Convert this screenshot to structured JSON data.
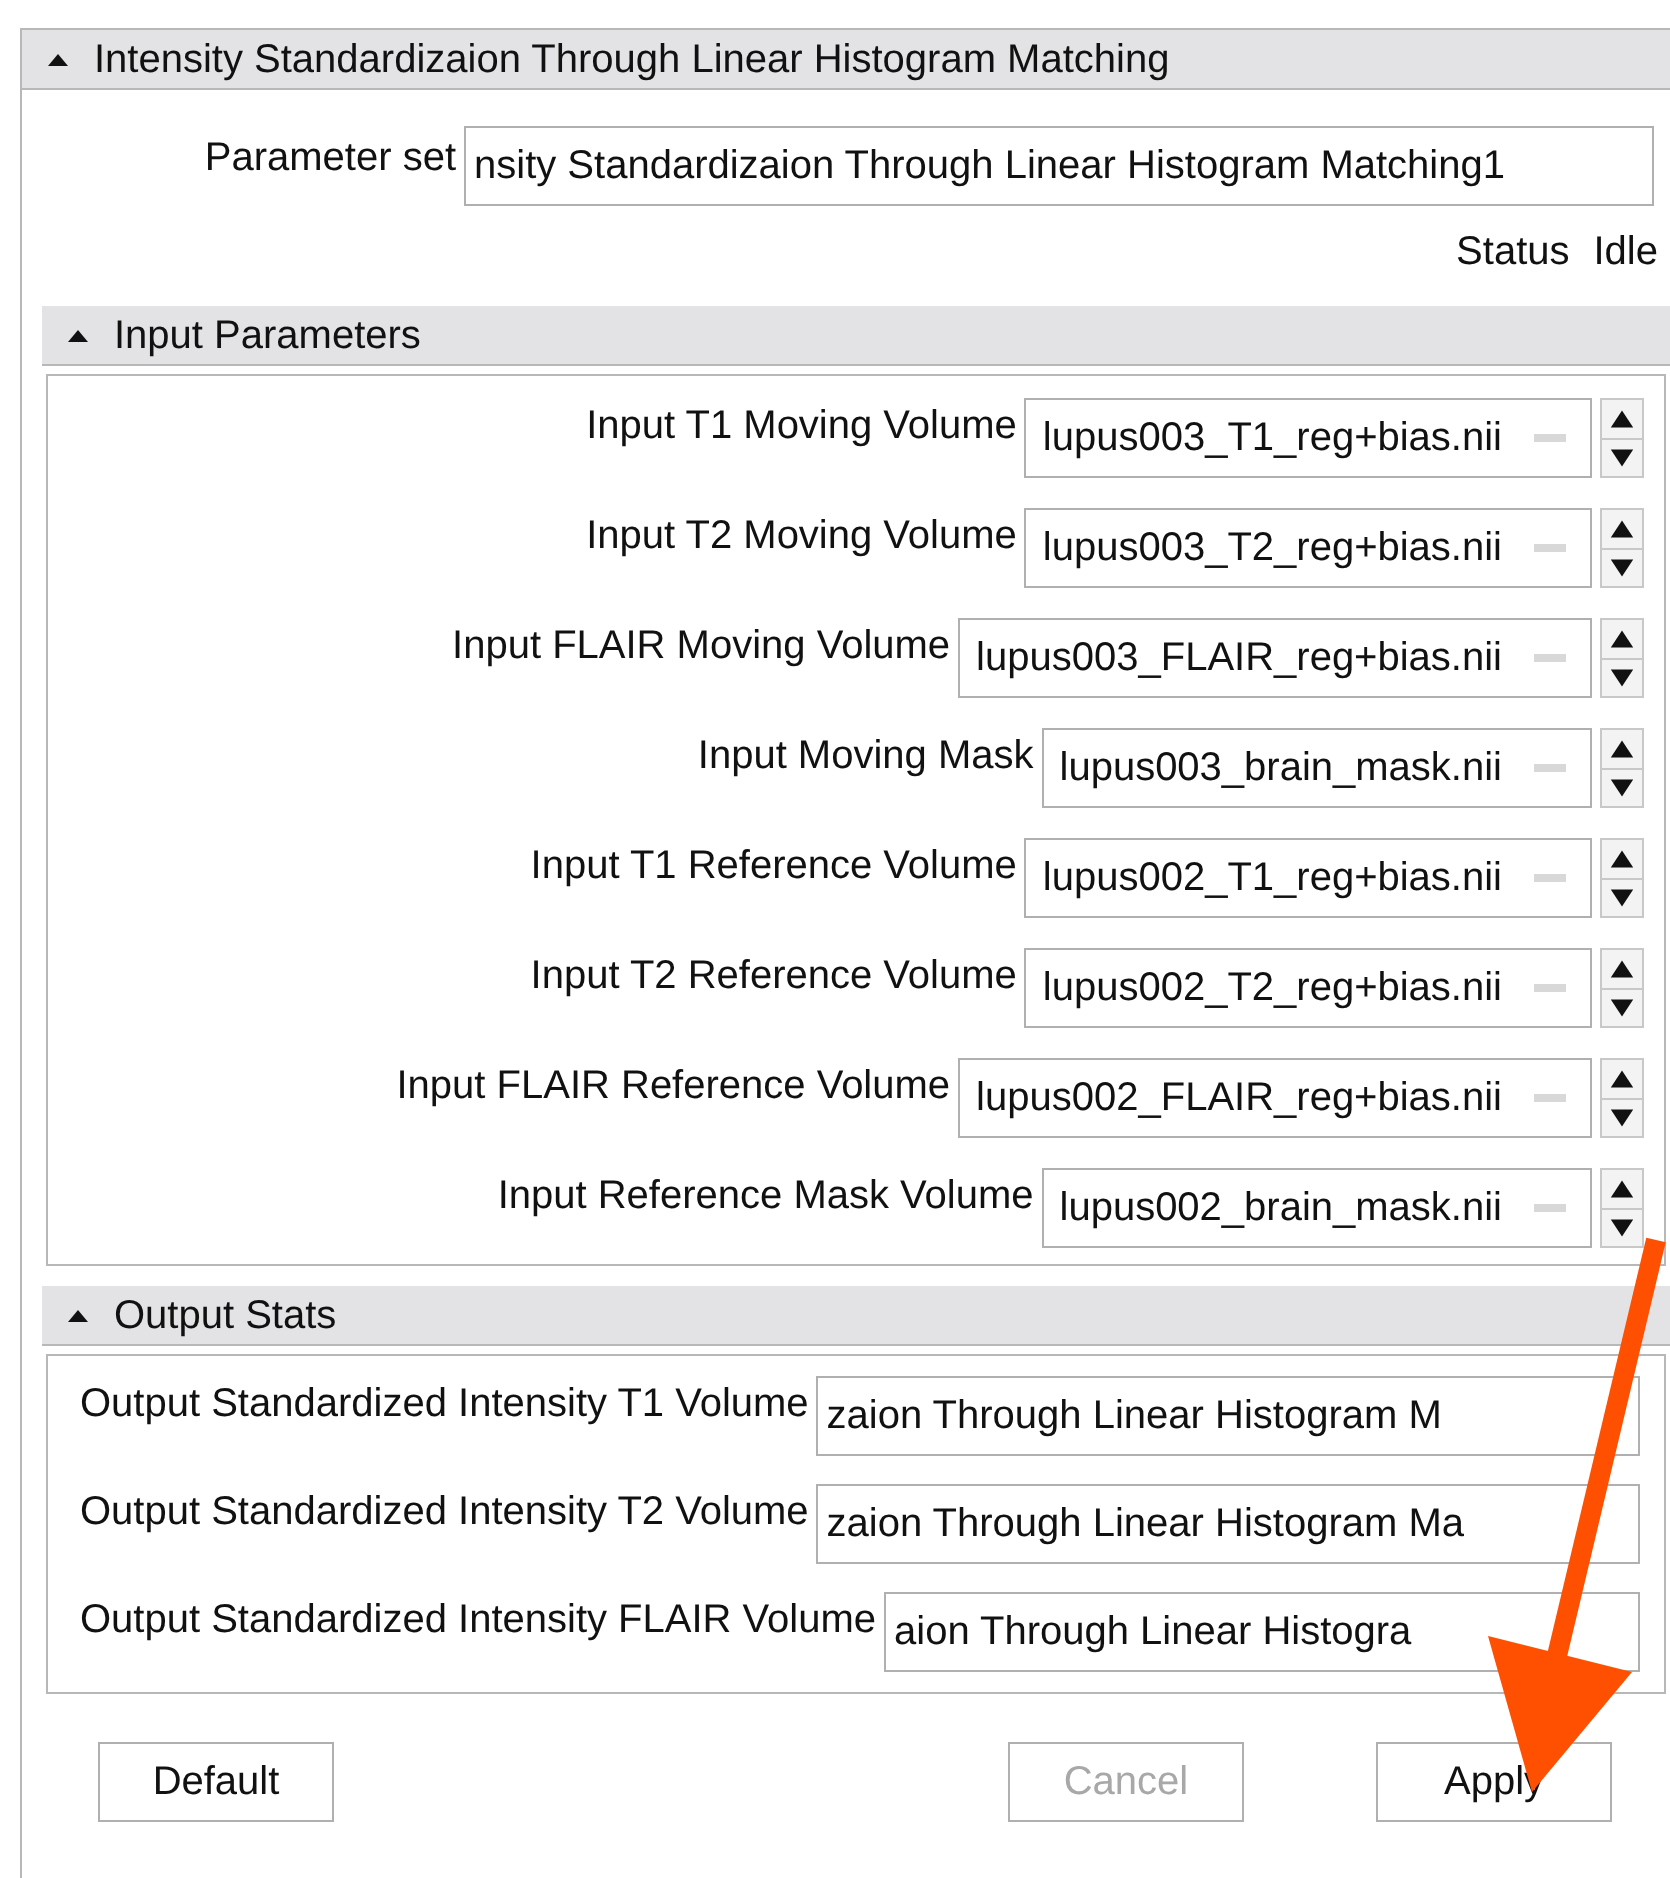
{
  "panel": {
    "title": "Intensity Standardizaion Through Linear Histogram Matching",
    "expanded": true
  },
  "parameter_set": {
    "label": "Parameter set",
    "value": "nsity Standardizaion Through Linear Histogram Matching1"
  },
  "status": {
    "label": "Status",
    "value": "Idle"
  },
  "input_parameters": {
    "title": "Input Parameters",
    "expanded": true,
    "rows": [
      {
        "label": "Input T1 Moving Volume",
        "value": "lupus003_T1_reg+bias.nii"
      },
      {
        "label": "Input T2 Moving Volume",
        "value": "lupus003_T2_reg+bias.nii"
      },
      {
        "label": "Input FLAIR Moving Volume",
        "value": "lupus003_FLAIR_reg+bias.nii"
      },
      {
        "label": "Input Moving Mask",
        "value": "lupus003_brain_mask.nii"
      },
      {
        "label": "Input T1 Reference Volume",
        "value": "lupus002_T1_reg+bias.nii"
      },
      {
        "label": "Input T2 Reference Volume",
        "value": "lupus002_T2_reg+bias.nii"
      },
      {
        "label": "Input FLAIR Reference Volume",
        "value": "lupus002_FLAIR_reg+bias.nii"
      },
      {
        "label": "Input Reference Mask Volume",
        "value": "lupus002_brain_mask.nii"
      }
    ]
  },
  "output_stats": {
    "title": "Output Stats",
    "expanded": true,
    "rows": [
      {
        "label": "Output Standardized Intensity T1 Volume",
        "value": "zaion Through Linear Histogram M"
      },
      {
        "label": "Output Standardized Intensity T2 Volume",
        "value": "zaion Through Linear Histogram Ma"
      },
      {
        "label": "Output Standardized Intensity FLAIR Volume",
        "value": "aion Through Linear Histogra"
      }
    ]
  },
  "buttons": [
    {
      "label": "Default",
      "disabled": false
    },
    {
      "label": "Cancel",
      "disabled": true
    },
    {
      "label": "Apply",
      "disabled": false
    }
  ]
}
